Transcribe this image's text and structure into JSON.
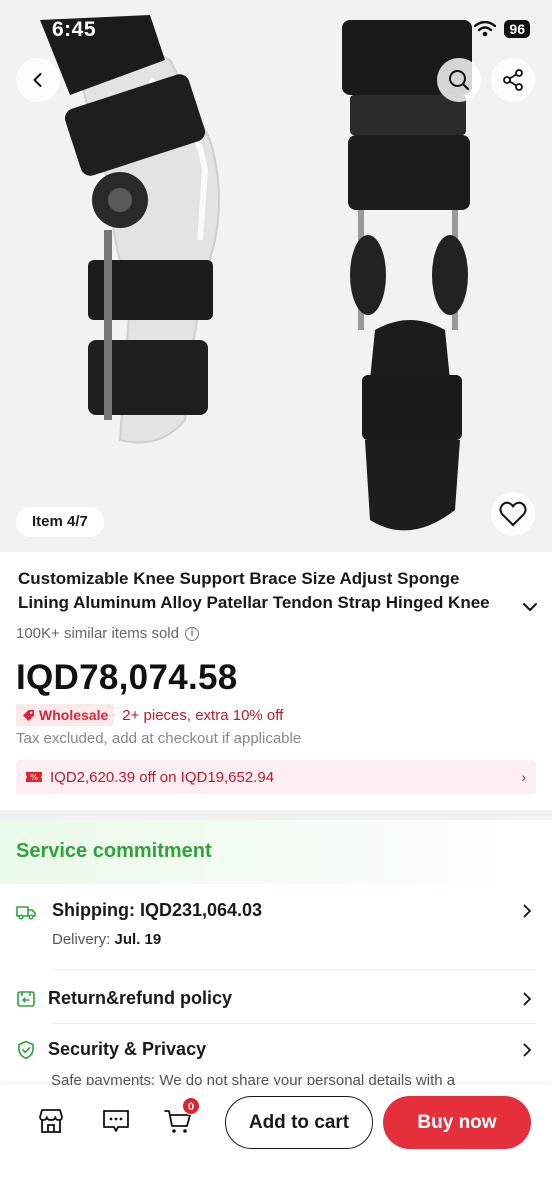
{
  "status_bar": {
    "time": "6:45",
    "battery": "96"
  },
  "gallery": {
    "counter": "Item 4/7"
  },
  "product": {
    "title": "Customizable Knee Support Brace Size Adjust Sponge Lining Aluminum Alloy Patellar Tendon Strap Hinged Knee",
    "sold": "100K+ similar items sold",
    "price": "IQD78,074.58",
    "wholesale_badge": "Wholesale",
    "wholesale_text": "2+ pieces, extra 10% off",
    "tax_note": "Tax excluded, add at checkout if applicable",
    "coupon": "IQD2,620.39 off on IQD19,652.94"
  },
  "service": {
    "title": "Service commitment",
    "shipping_label": "Shipping: IQD231,064.03",
    "delivery_prefix": "Delivery: ",
    "delivery_date": "Jul. 19",
    "return_label": "Return&refund policy",
    "security_label": "Security & Privacy",
    "security_sub": "Safe payments: We do not share your personal details with a"
  },
  "bottom_bar": {
    "cart_count": "0",
    "add_to_cart": "Add to cart",
    "buy_now": "Buy now"
  },
  "colors": {
    "accent_red": "#e5303c",
    "service_green": "#2ea33a",
    "price_red_text": "#c0182c"
  }
}
